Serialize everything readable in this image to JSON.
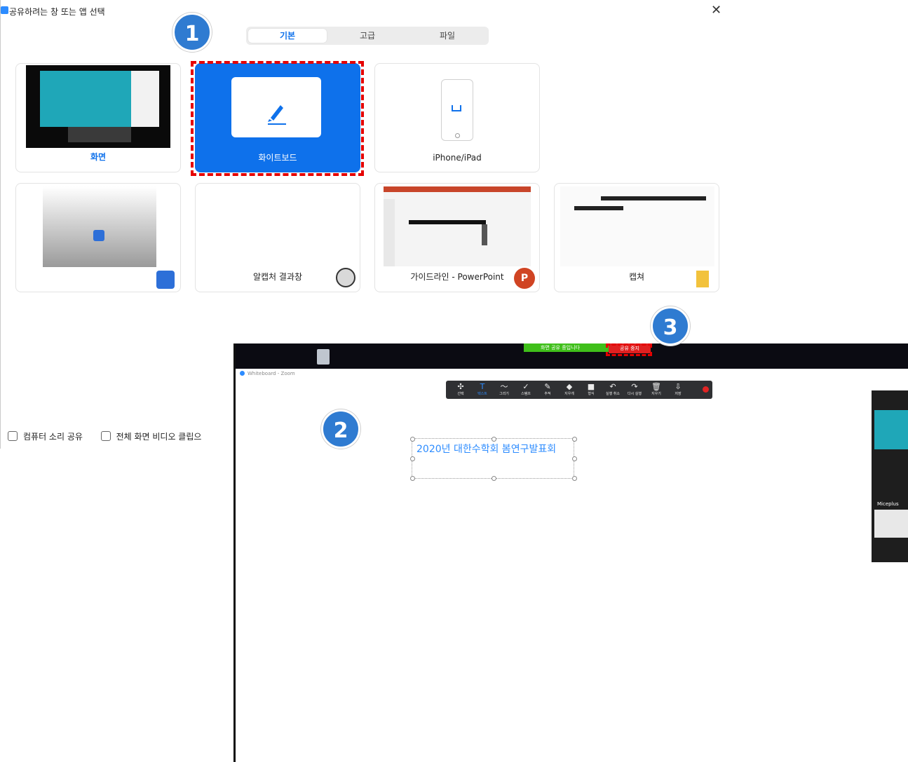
{
  "dialog": {
    "title": "공유하려는 창 또는 앱 선택",
    "close_label": "✕",
    "tabs": [
      {
        "label": "기본",
        "active": true
      },
      {
        "label": "고급",
        "active": false
      },
      {
        "label": "파일",
        "active": false
      }
    ],
    "cards": [
      {
        "label": "화면",
        "kind": "screen"
      },
      {
        "label": "화이트보드",
        "kind": "whiteboard"
      },
      {
        "label": "iPhone/iPad",
        "kind": "device"
      },
      {
        "label": "",
        "kind": "window"
      },
      {
        "label": "알캡처 결과창",
        "kind": "app"
      },
      {
        "label": "가이드라인 - PowerPoint",
        "kind": "app"
      },
      {
        "label": "캡쳐",
        "kind": "folder"
      }
    ],
    "options": [
      {
        "label": "컴퓨터 소리 공유",
        "checked": false
      },
      {
        "label": "전체 화면 비디오 클립으",
        "checked": false
      }
    ]
  },
  "whiteboard_window": {
    "title": "Whiteboard - Zoom",
    "share_status": "화면 공유 중입니다",
    "stop_share": "공유 중지",
    "toolbar": [
      {
        "label": "선택",
        "icon": "move-icon",
        "glyph": "✣"
      },
      {
        "label": "텍스트",
        "icon": "text-icon",
        "glyph": "T"
      },
      {
        "label": "그리기",
        "icon": "draw-icon",
        "glyph": "〜"
      },
      {
        "label": "스탬프",
        "icon": "stamp-icon",
        "glyph": "✓"
      },
      {
        "label": "추적",
        "icon": "pen-icon",
        "glyph": "✎"
      },
      {
        "label": "지우개",
        "icon": "eraser-icon",
        "glyph": "◆"
      },
      {
        "label": "형식",
        "icon": "format-icon",
        "glyph": "■"
      },
      {
        "label": "실행 취소",
        "icon": "undo-icon",
        "glyph": "↶"
      },
      {
        "label": "다시 실행",
        "icon": "redo-icon",
        "glyph": "↷"
      },
      {
        "label": "지우기",
        "icon": "trash-icon",
        "glyph": "🗑"
      },
      {
        "label": "저장",
        "icon": "save-icon",
        "glyph": "⇩"
      }
    ],
    "text_content": "2020년 대한수학회 봄연구발표회",
    "participant": "Miceplus"
  },
  "badges": [
    "1",
    "2",
    "3"
  ],
  "colors": {
    "accent": "#0e71eb",
    "highlight": "#e50000",
    "badge": "#2f7bd1"
  }
}
